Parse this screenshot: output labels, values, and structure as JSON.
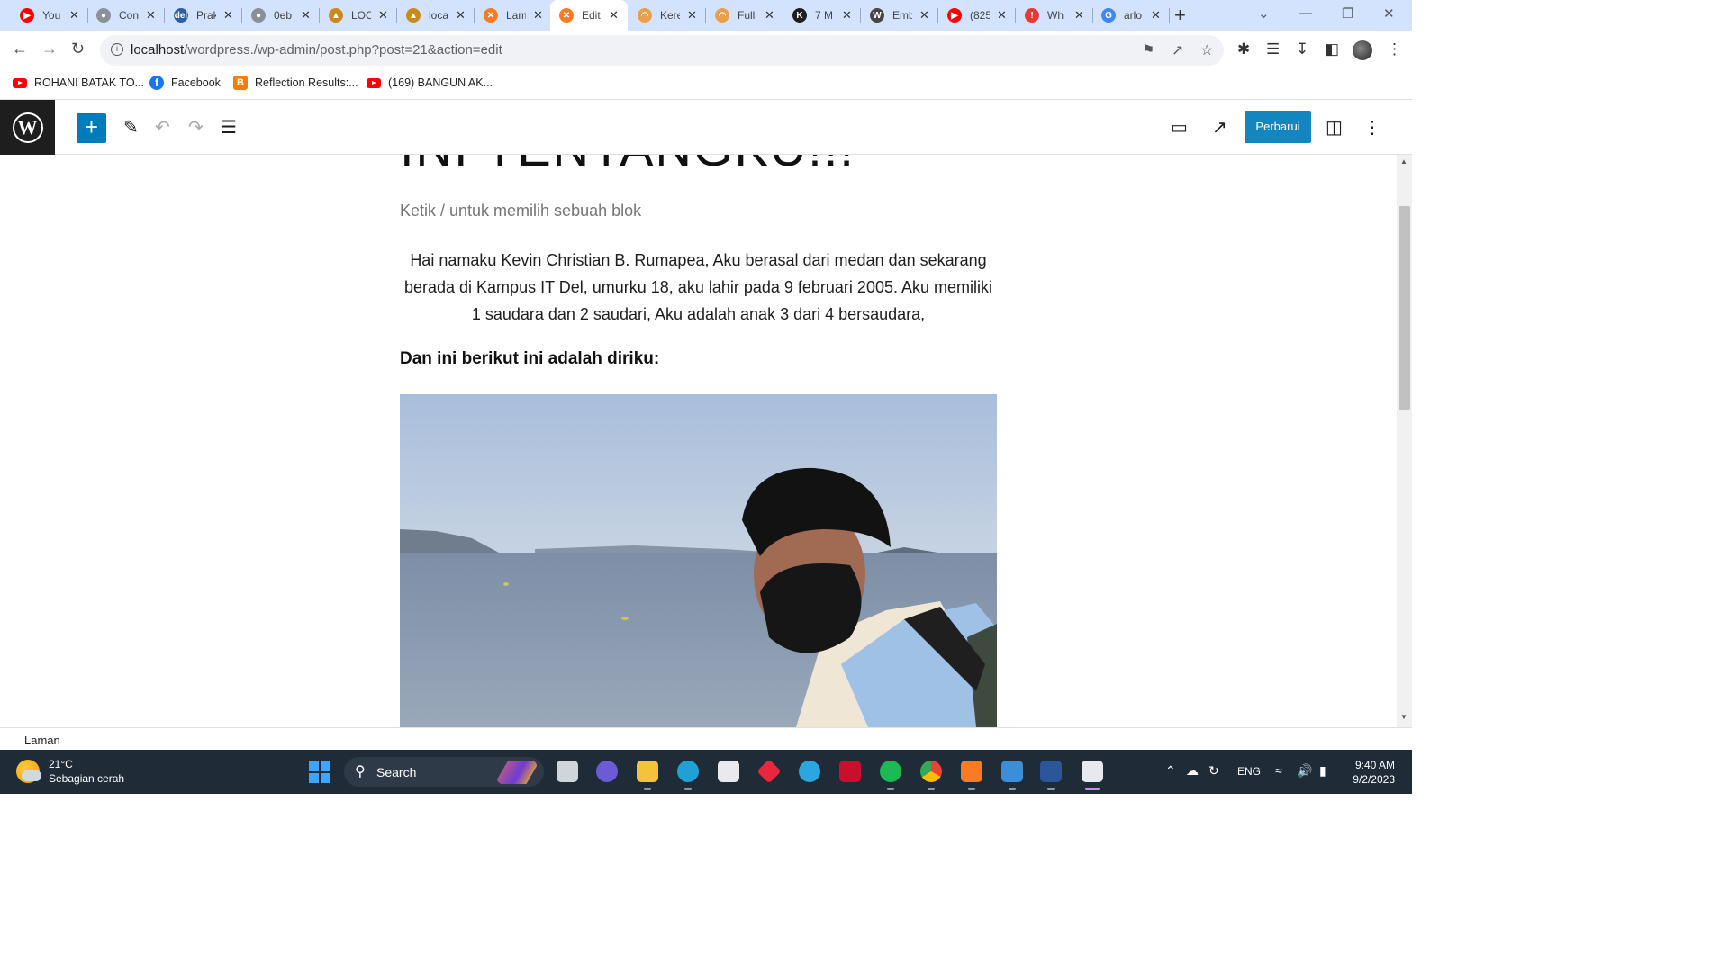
{
  "browser": {
    "tabs": [
      {
        "title": "You",
        "favicon_color": "#ff0000",
        "glyph": "▶"
      },
      {
        "title": "Con",
        "favicon_color": "#8a8f98",
        "glyph": "●"
      },
      {
        "title": "Prak",
        "favicon_color": "#2d5fa8",
        "glyph": "del"
      },
      {
        "title": "0eb",
        "favicon_color": "#8a8f98",
        "glyph": "●"
      },
      {
        "title": "LOC",
        "favicon_color": "#c98a1a",
        "glyph": "▲"
      },
      {
        "title": "loca",
        "favicon_color": "#c98a1a",
        "glyph": "▲"
      },
      {
        "title": "Lam",
        "favicon_color": "#fb7a24",
        "glyph": "✕"
      },
      {
        "title": "Edit",
        "favicon_color": "#fb7a24",
        "glyph": "✕"
      },
      {
        "title": "Kere",
        "favicon_color": "#e8a04d",
        "glyph": "◠"
      },
      {
        "title": "Full",
        "favicon_color": "#e8a04d",
        "glyph": "◠"
      },
      {
        "title": "7 M",
        "favicon_color": "#1e1e1e",
        "glyph": "K"
      },
      {
        "title": "Emb",
        "favicon_color": "#464646",
        "glyph": "W"
      },
      {
        "title": "(825",
        "favicon_color": "#ff0000",
        "glyph": "▶"
      },
      {
        "title": "Wh",
        "favicon_color": "#e53935",
        "glyph": "!"
      },
      {
        "title": "arlo",
        "favicon_color": "#4285f4",
        "glyph": "G"
      }
    ],
    "active_tab_index": 7,
    "new_tab_icon": "plus-icon",
    "url_host": "localhost",
    "url_path": "/wordpress./wp-admin/post.php?post=21&action=edit",
    "bookmarks": [
      {
        "label": "ROHANI BATAK TO...",
        "icon": "youtube-icon"
      },
      {
        "label": "Facebook",
        "icon": "facebook-icon"
      },
      {
        "label": "Reflection Results:...",
        "icon": "blogger-icon"
      },
      {
        "label": "(169) BANGUN AK...",
        "icon": "youtube-icon"
      }
    ]
  },
  "editor": {
    "update_button": "Perbarui",
    "post_title_fragment": "INI TENTANGKU!!!",
    "block_placeholder": "Ketik / untuk memilih sebuah blok",
    "paragraph": "Hai namaku Kevin Christian B. Rumapea, Aku berasal dari medan dan sekarang berada di Kampus IT Del, umurku 18, aku lahir pada 9 februari 2005. Aku memiliki 1 saudara dan 2 saudari, Aku adalah anak 3 dari 4 bersaudara,",
    "heading": "Dan ini berikut ini adalah diriku:",
    "breadcrumb": "Laman",
    "accent_color": "#007cba"
  },
  "taskbar": {
    "temperature": "21°C",
    "weather": "Sebagian cerah",
    "search_label": "Search",
    "language": "ENG",
    "time": "9:40 AM",
    "date": "9/2/2023"
  }
}
